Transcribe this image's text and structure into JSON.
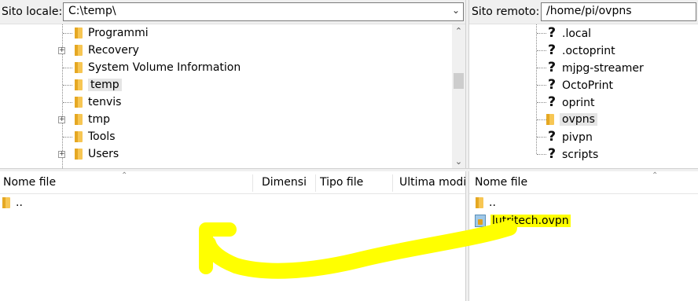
{
  "local": {
    "label": "Sito locale:",
    "path": "C:\\temp\\",
    "tree": [
      {
        "name": "Programmi",
        "expandable": false,
        "icon": "folder"
      },
      {
        "name": "Recovery",
        "expandable": true,
        "icon": "folder-shared"
      },
      {
        "name": "System Volume Information",
        "expandable": false,
        "icon": "folder"
      },
      {
        "name": "temp",
        "expandable": false,
        "icon": "folder",
        "selected": true
      },
      {
        "name": "tenvis",
        "expandable": false,
        "icon": "folder"
      },
      {
        "name": "tmp",
        "expandable": true,
        "icon": "folder"
      },
      {
        "name": "Tools",
        "expandable": false,
        "icon": "folder"
      },
      {
        "name": "Users",
        "expandable": true,
        "icon": "folder"
      }
    ],
    "columns": [
      "Nome file",
      "Dimensi",
      "Tipo file",
      "Ultima modi"
    ],
    "files": [
      {
        "name": "..",
        "icon": "folder"
      }
    ]
  },
  "remote": {
    "label": "Sito remoto:",
    "path": "/home/pi/ovpns",
    "tree": [
      {
        "name": ".local",
        "icon": "question-icon"
      },
      {
        "name": ".octoprint",
        "icon": "question-icon"
      },
      {
        "name": "mjpg-streamer",
        "icon": "question-icon"
      },
      {
        "name": "OctoPrint",
        "icon": "question-icon"
      },
      {
        "name": "oprint",
        "icon": "question-icon"
      },
      {
        "name": "ovpns",
        "icon": "folder",
        "selected": true
      },
      {
        "name": "pivpn",
        "icon": "question-icon"
      },
      {
        "name": "scripts",
        "icon": "question-icon"
      }
    ],
    "columns": [
      "Nome file"
    ],
    "files": [
      {
        "name": "..",
        "icon": "folder"
      },
      {
        "name": "lutritech.ovpn",
        "icon": "file-icon",
        "highlighted": true
      }
    ]
  },
  "annotation": {
    "color": "#ffff00",
    "description_icon": "arrow-icon"
  },
  "icons": {
    "expander": "plus-icon",
    "dropdown": "chevron-down-icon",
    "scroll_up": "chevron-up-icon"
  }
}
